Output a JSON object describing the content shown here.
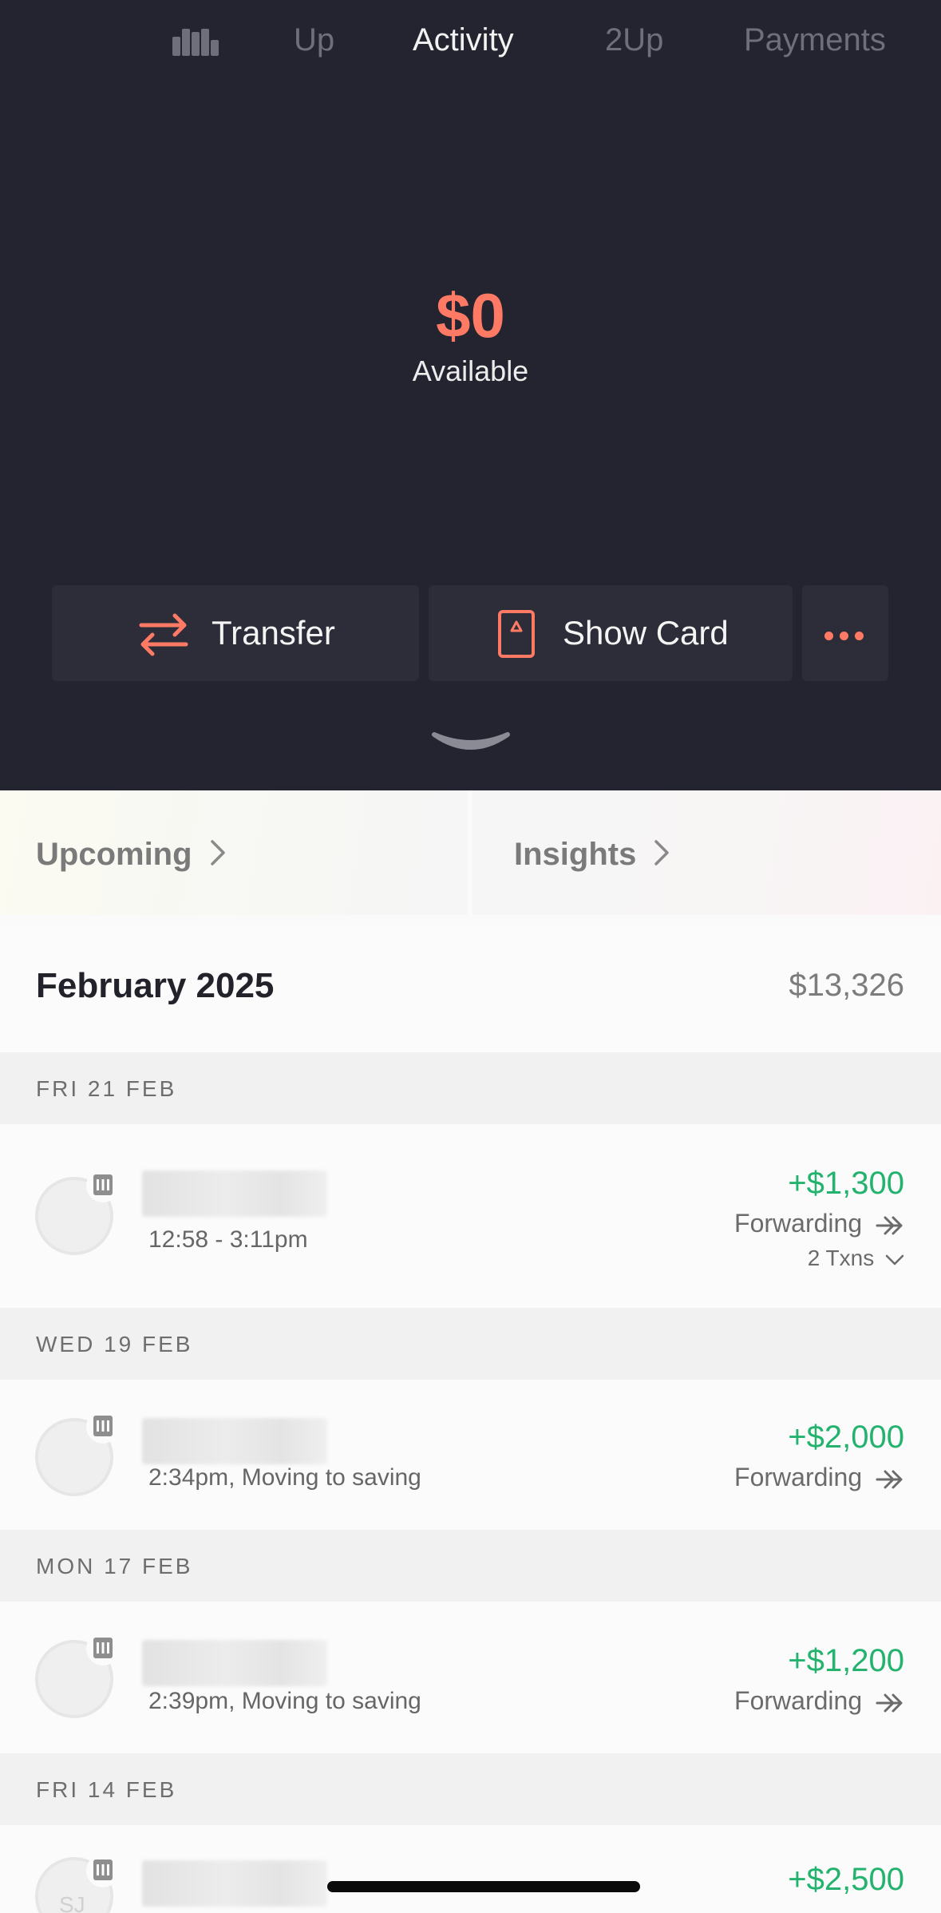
{
  "nav": {
    "tabs": [
      {
        "label": "Up",
        "active": false
      },
      {
        "label": "Activity",
        "active": true
      },
      {
        "label": "2Up",
        "active": false
      },
      {
        "label": "Payments",
        "active": false
      }
    ],
    "insights_icon": "bar-chart-icon"
  },
  "balance": {
    "amount": "$0",
    "label": "Available"
  },
  "actions": {
    "transfer_label": "Transfer",
    "show_card_label": "Show Card",
    "more_icon": "more-dots-icon"
  },
  "cards": {
    "upcoming_label": "Upcoming",
    "insights_label": "Insights"
  },
  "month": {
    "title": "February 2025",
    "total": "$13,326"
  },
  "days": [
    {
      "header": "FRI 21 FEB",
      "transactions": [
        {
          "subtitle": "12:58 - 3:11pm",
          "amount": "+$1,300",
          "type": "Forwarding",
          "count": "2 Txns"
        }
      ]
    },
    {
      "header": "WED 19 FEB",
      "transactions": [
        {
          "subtitle": "2:34pm, Moving to saving",
          "amount": "+$2,000",
          "type": "Forwarding"
        }
      ]
    },
    {
      "header": "MON 17 FEB",
      "transactions": [
        {
          "subtitle": "2:39pm, Moving to saving",
          "amount": "+$1,200",
          "type": "Forwarding"
        }
      ]
    },
    {
      "header": "FRI 14 FEB",
      "transactions": [
        {
          "initials": "SJ",
          "amount": "+$2,500"
        }
      ]
    }
  ],
  "colors": {
    "background_dark": "#242430",
    "accent": "#ff7a64",
    "positive": "#23b36e"
  }
}
